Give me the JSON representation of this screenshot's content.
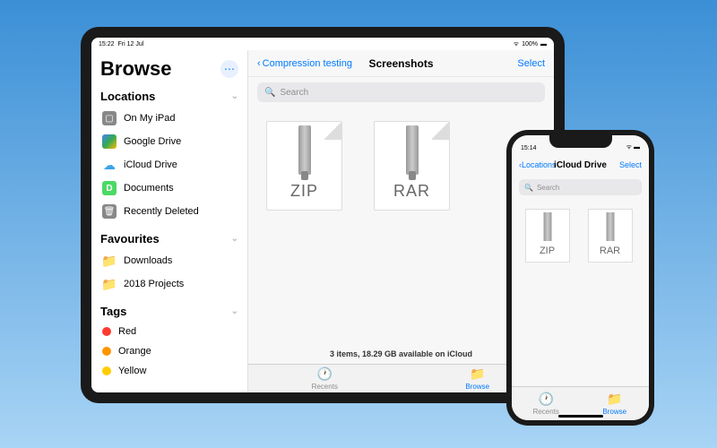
{
  "ipad": {
    "status": {
      "time": "15:22",
      "date": "Fri 12 Jul",
      "battery": "100%"
    },
    "browse_title": "Browse",
    "sections": {
      "locations": {
        "title": "Locations",
        "items": [
          {
            "label": "On My iPad",
            "icon": "ipad"
          },
          {
            "label": "Google Drive",
            "icon": "gdrive"
          },
          {
            "label": "iCloud Drive",
            "icon": "icloud"
          },
          {
            "label": "Documents",
            "icon": "docs"
          },
          {
            "label": "Recently Deleted",
            "icon": "trash"
          }
        ]
      },
      "favourites": {
        "title": "Favourites",
        "items": [
          {
            "label": "Downloads"
          },
          {
            "label": "2018 Projects"
          }
        ]
      },
      "tags": {
        "title": "Tags",
        "items": [
          {
            "label": "Red",
            "color": "#ff3b30"
          },
          {
            "label": "Orange",
            "color": "#ff9500"
          },
          {
            "label": "Yellow",
            "color": "#ffcc00"
          }
        ]
      }
    },
    "nav": {
      "back": "Compression testing",
      "title": "Screenshots",
      "select": "Select"
    },
    "search_placeholder": "Search",
    "files": [
      {
        "label": "ZIP"
      },
      {
        "label": "RAR"
      }
    ],
    "footer": "3 items, 18.29 GB available on iCloud",
    "tabs": {
      "recents": "Recents",
      "browse": "Browse"
    }
  },
  "iphone": {
    "status": {
      "time": "15:14"
    },
    "nav": {
      "back": "Locations",
      "title": "iCloud Drive",
      "select": "Select"
    },
    "search_placeholder": "Search",
    "files": [
      {
        "label": "ZIP"
      },
      {
        "label": "RAR"
      }
    ],
    "tabs": {
      "recents": "Recents",
      "browse": "Browse"
    }
  }
}
